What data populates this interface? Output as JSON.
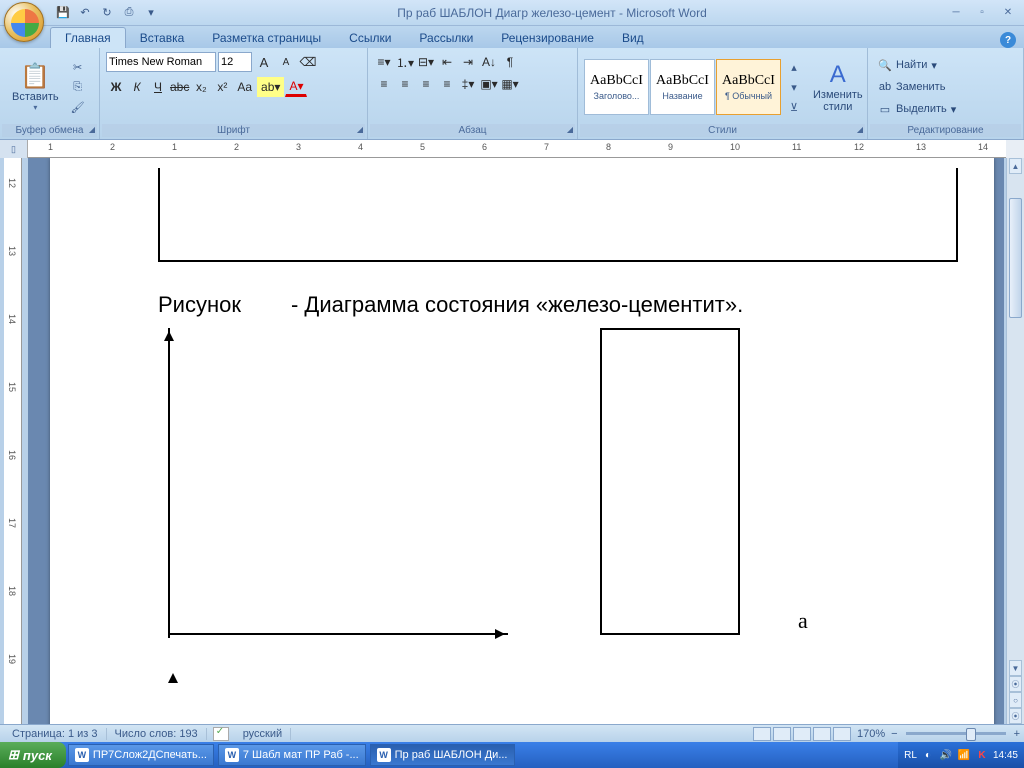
{
  "app": {
    "title": "Пр раб ШАБЛОН Диагр железо-цемент - Microsoft Word"
  },
  "qat": {
    "save": "💾",
    "undo": "↶",
    "redo": "↻",
    "print": "⎙"
  },
  "tabs": {
    "home": "Главная",
    "insert": "Вставка",
    "layout": "Разметка страницы",
    "refs": "Ссылки",
    "mail": "Рассылки",
    "review": "Рецензирование",
    "view": "Вид"
  },
  "ribbon": {
    "clipboard": {
      "label": "Буфер обмена",
      "paste": "Вставить"
    },
    "font": {
      "label": "Шрифт",
      "name": "Times New Roman",
      "size": "12",
      "bold": "Ж",
      "italic": "К",
      "underline": "Ч",
      "strike": "abc",
      "sub": "x₂",
      "sup": "x²",
      "case": "Aa",
      "grow": "A",
      "shrink": "A",
      "hl": "ab",
      "color": "A"
    },
    "para": {
      "label": "Абзац"
    },
    "styles": {
      "label": "Стили",
      "s1": {
        "preview": "AaBbCcI",
        "name": "Заголово..."
      },
      "s2": {
        "preview": "AaBbCcI",
        "name": "Название"
      },
      "s3": {
        "preview": "AaBbCcI",
        "name": "¶ Обычный"
      },
      "change": "Изменить\nстили"
    },
    "editing": {
      "label": "Редактирование",
      "find": "Найти",
      "replace": "Заменить",
      "select": "Выделить"
    }
  },
  "document": {
    "line1a": "Рисунок",
    "line1b": "- Диаграмма состояния «железо-цементит».",
    "letter": "a"
  },
  "status": {
    "page": "Страница: 1 из 3",
    "words": "Число слов: 193",
    "lang": "русский",
    "zoom": "170%"
  },
  "taskbar": {
    "start": "пуск",
    "t1": "ПР7Слож2ДСпечать...",
    "t2": "7 Шабл мат ПР Раб -...",
    "t3": "Пр раб ШАБЛОН Ди...",
    "lang": "RL",
    "time": "14:45"
  },
  "ruler": {
    "nums": [
      "1",
      "2",
      "1",
      "2",
      "3",
      "4",
      "5",
      "6",
      "7",
      "8",
      "9",
      "10",
      "11",
      "12",
      "13",
      "14"
    ],
    "vnums": [
      "12",
      "13",
      "14",
      "15",
      "16",
      "17",
      "18",
      "19"
    ]
  }
}
